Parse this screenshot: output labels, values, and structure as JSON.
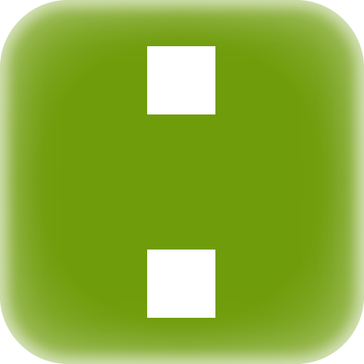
{
  "icon": {
    "name": "green-app-icon",
    "background_color": "#6f9c0a",
    "symbol_color": "#ffffff",
    "symbols": [
      {
        "name": "top-square-icon"
      },
      {
        "name": "bottom-square-icon"
      }
    ]
  }
}
